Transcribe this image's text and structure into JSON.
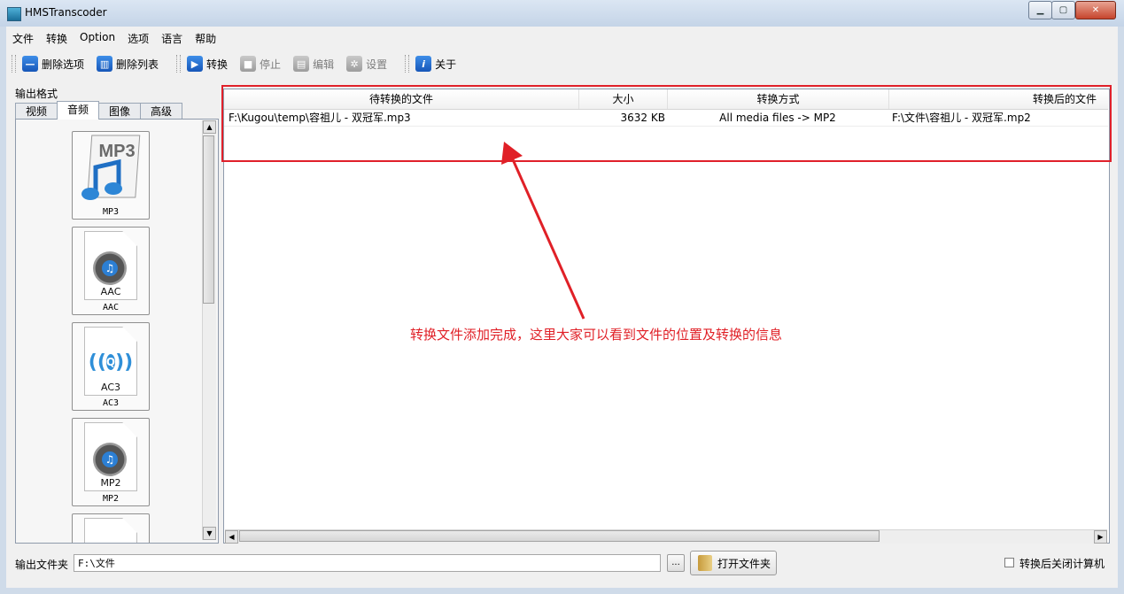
{
  "window": {
    "title": "HMSTranscoder"
  },
  "menu": [
    "文件",
    "转换",
    "Option",
    "选项",
    "语言",
    "帮助"
  ],
  "toolbar": [
    {
      "label": "删除选项",
      "icon": "minus-icon",
      "enabled": true
    },
    {
      "label": "删除列表",
      "icon": "trash-icon",
      "enabled": true
    },
    {
      "label": "转换",
      "icon": "play-icon",
      "enabled": true
    },
    {
      "label": "停止",
      "icon": "stop-icon",
      "enabled": false
    },
    {
      "label": "编辑",
      "icon": "film-edit-icon",
      "enabled": false
    },
    {
      "label": "设置",
      "icon": "gear-icon",
      "enabled": false
    },
    {
      "label": "关于",
      "icon": "info-icon",
      "enabled": true
    }
  ],
  "left_panel": {
    "label": "输出格式",
    "tabs": [
      "视频",
      "音频",
      "图像",
      "高级"
    ],
    "active_tab": "音频",
    "formats": [
      {
        "icon_text": "MP3",
        "caption": "MP3"
      },
      {
        "icon_text": "AAC",
        "caption": "AAC"
      },
      {
        "icon_text": "AC3",
        "caption": "AC3"
      },
      {
        "icon_text": "MP2",
        "caption": "MP2"
      }
    ]
  },
  "file_list": {
    "columns": [
      "待转换的文件",
      "大小",
      "转换方式",
      "转换后的文件"
    ],
    "rows": [
      [
        "F:\\Kugou\\temp\\容祖儿 - 双冠军.mp3",
        "3632 KB",
        "All media files -> MP2",
        "F:\\文件\\容祖儿 - 双冠军.mp2"
      ]
    ]
  },
  "annotation": {
    "text": "转换文件添加完成，这里大家可以看到文件的位置及转换的信息",
    "color": "#e02027"
  },
  "bottom": {
    "output_folder_label": "输出文件夹",
    "output_folder_value": "F:\\文件",
    "browse_label": "...",
    "open_folder_label": "打开文件夹",
    "shutdown_label": "转换后关闭计算机",
    "shutdown_checked": false
  }
}
